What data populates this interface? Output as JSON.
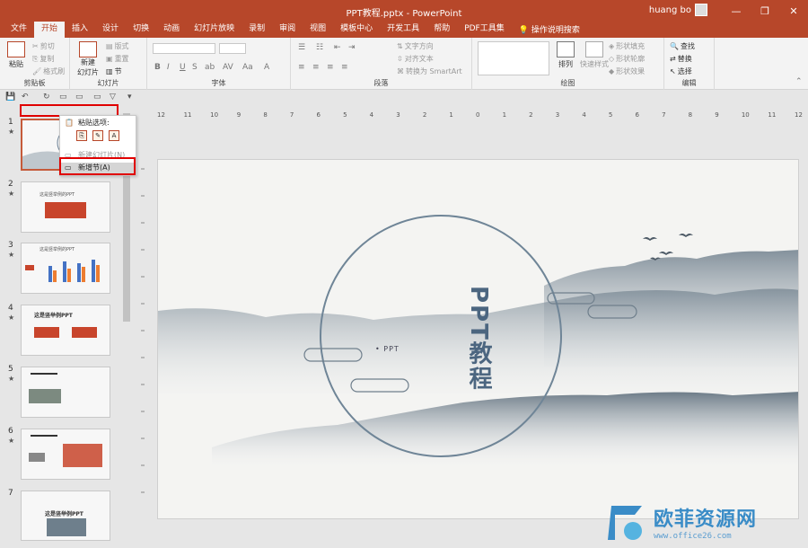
{
  "window": {
    "title": "PPT教程.pptx  -  PowerPoint",
    "user": "huang bo",
    "controls": [
      "—",
      "❐",
      "✕"
    ]
  },
  "tabs": [
    "文件",
    "开始",
    "插入",
    "设计",
    "切换",
    "动画",
    "幻灯片放映",
    "录制",
    "审阅",
    "视图",
    "模板中心",
    "开发工具",
    "帮助",
    "PDF工具集"
  ],
  "active_tab": "开始",
  "tell_me": "操作说明搜索",
  "ribbon": {
    "clipboard": {
      "label": "剪贴板",
      "paste": "粘贴",
      "cut": "剪切",
      "copy": "复制",
      "format_painter": "格式刷"
    },
    "slides": {
      "label": "幻灯片",
      "new_slide": "新建",
      "new_slide2": "幻灯片",
      "layout": "版式",
      "reset": "重置",
      "section": "节"
    },
    "font": {
      "label": "字体"
    },
    "paragraph": {
      "label": "段落",
      "text_direction": "文字方向",
      "align_text": "对齐文本",
      "smartart": "转换为 SmartArt"
    },
    "drawing": {
      "label": "绘图",
      "arrange": "排列",
      "quick_styles": "快速样式",
      "shape_fill": "形状填充",
      "shape_outline": "形状轮廓",
      "shape_effects": "形状效果"
    },
    "editing": {
      "label": "编辑",
      "find": "查找",
      "replace": "替换",
      "select": "选择"
    }
  },
  "context_menu": {
    "paste_options": "粘贴选项:",
    "paste_icons": [
      "⎘",
      "✎",
      "A"
    ],
    "new_slide": "新建幻灯片(N)",
    "add_section": "新增节(A)"
  },
  "thumbnails": [
    {
      "num": "1",
      "star": "★",
      "text": ""
    },
    {
      "num": "2",
      "star": "★",
      "text": "这是竖举例的PPT"
    },
    {
      "num": "3",
      "star": "★",
      "text": "这是竖举例的PPT"
    },
    {
      "num": "4",
      "star": "★",
      "text": "这是竖举例PPT"
    },
    {
      "num": "5",
      "star": "★",
      "text": ""
    },
    {
      "num": "6",
      "star": "★",
      "text": ""
    },
    {
      "num": "7",
      "star": "",
      "text": "这是竖举例PPT"
    }
  ],
  "ruler": [
    "12",
    "11",
    "10",
    "9",
    "8",
    "7",
    "6",
    "5",
    "4",
    "3",
    "2",
    "1",
    "0",
    "1",
    "2",
    "3",
    "4",
    "5",
    "6",
    "7",
    "8",
    "9",
    "10",
    "11",
    "12"
  ],
  "slide": {
    "title": "PPT教程",
    "subtitle": "• PPT"
  },
  "watermark": {
    "text": "欧菲资源网",
    "url": "www.office26.com"
  },
  "colors": {
    "accent": "#b7472a",
    "slide_text": "#4c6680",
    "watermark": "#3a8cc7",
    "highlight_box": "#e00000"
  }
}
